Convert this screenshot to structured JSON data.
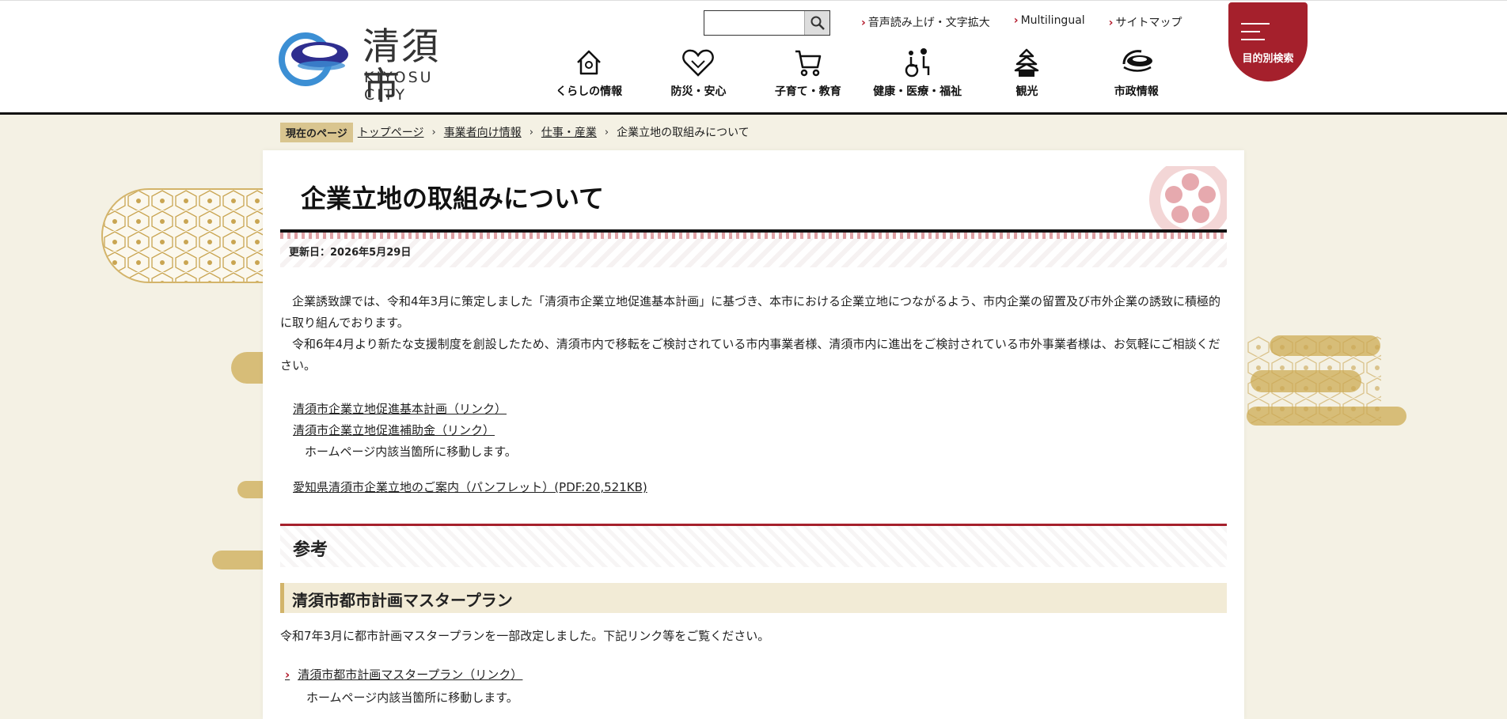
{
  "header": {
    "logo_jp": "清須市",
    "logo_en": "KIYOSU CITY",
    "search": {
      "placeholder": "",
      "value": ""
    },
    "util_links": [
      {
        "label": "音声読み上げ・文字拡大"
      },
      {
        "label": "Multilingual"
      },
      {
        "label": "サイトマップ"
      }
    ],
    "gnav": [
      {
        "label": "くらしの情報",
        "icon": "house-icon"
      },
      {
        "label": "防災・安心",
        "icon": "heart-hands-icon"
      },
      {
        "label": "子育て・教育",
        "icon": "stroller-icon"
      },
      {
        "label": "健康・医療・福祉",
        "icon": "wheelchair-icon"
      },
      {
        "label": "観光",
        "icon": "castle-icon"
      },
      {
        "label": "市政情報",
        "icon": "city-emblem-icon"
      }
    ],
    "purpose_search": "目的別検索"
  },
  "breadcrumb": {
    "current_label": "現在のページ",
    "items": [
      "トップページ",
      "事業者向け情報",
      "仕事・産業"
    ],
    "here": "企業立地の取組みについて"
  },
  "main": {
    "title": "企業立地の取組みについて",
    "updated": "更新日：2026年5月29日",
    "paragraphs": [
      "企業誘致課では、令和4年3月に策定しました「清須市企業立地促進基本計画」に基づき、本市における企業立地につながるよう、市内企業の留置及び市外企業の誘致に積極的に取り組んでおります。",
      "令和6年4月より新たな支援制度を創設したため、清須市内で移転をご検討されている市内事業者様、清須市内に進出をご検討されている市外事業者様は、お気軽にご相談ください。"
    ],
    "links": [
      "清須市企業立地促進基本計画（リンク）",
      "清須市企業立地促進補助金（リンク）"
    ],
    "links_note": "ホームページ内該当箇所に移動します。",
    "pdf_link": "愛知県清須市企業立地のご案内（パンフレット）(PDF:20,521KB)",
    "reference_heading": "参考",
    "section": {
      "heading": "清須市都市計画マスタープラン",
      "body": "令和7年3月に都市計画マスタープランを一部改定しました。下記リンク等をご覧ください。",
      "link": "清須市都市計画マスタープラン（リンク）",
      "note": "ホームページ内該当箇所に移動します。"
    }
  },
  "colors": {
    "accent_red": "#a5202c",
    "gold": "#d2b46a",
    "background": "#f4f1e4"
  }
}
